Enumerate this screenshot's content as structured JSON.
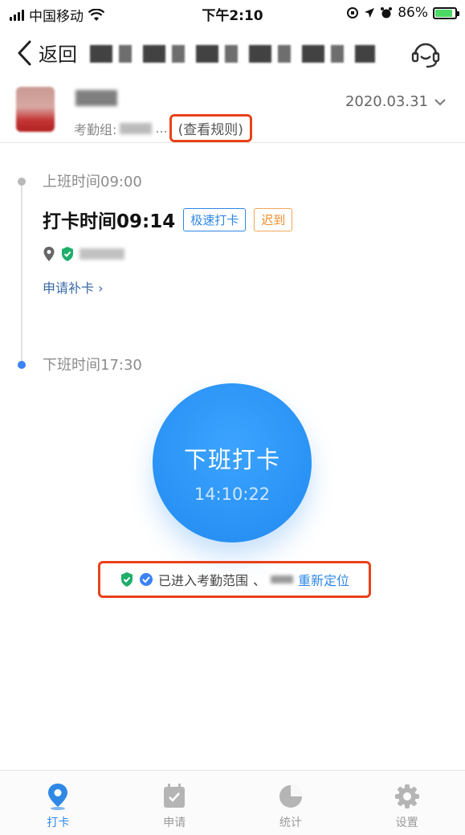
{
  "status_bar": {
    "carrier": "中国移动",
    "time": "下午2:10",
    "battery": "86%",
    "battery_level": 0.86
  },
  "nav": {
    "back_label": "返回"
  },
  "user": {
    "group_label": "考勤组:",
    "group_suffix": "...",
    "rules_link": "(查看规则)",
    "date": "2020.03.31"
  },
  "checkin": {
    "label": "上班时间09:00",
    "punch": "打卡时间09:14",
    "tag_fast": "极速打卡",
    "tag_late": "迟到",
    "apply": "申请补卡",
    "apply_chevron": "›"
  },
  "checkout": {
    "label": "下班时间17:30",
    "button_label": "下班打卡",
    "clock": "14:10:22"
  },
  "range": {
    "status": "已进入考勤范围",
    "separator": "、",
    "relocate": "重新定位"
  },
  "tabs": [
    {
      "label": "打卡",
      "icon": "location-pin-icon",
      "active": true
    },
    {
      "label": "申请",
      "icon": "calendar-check-icon",
      "active": false
    },
    {
      "label": "统计",
      "icon": "pie-chart-icon",
      "active": false
    },
    {
      "label": "设置",
      "icon": "gear-icon",
      "active": false
    }
  ],
  "colors": {
    "accent": "#2f88e6",
    "late": "#f08c2a",
    "highlight": "#e8421a"
  }
}
